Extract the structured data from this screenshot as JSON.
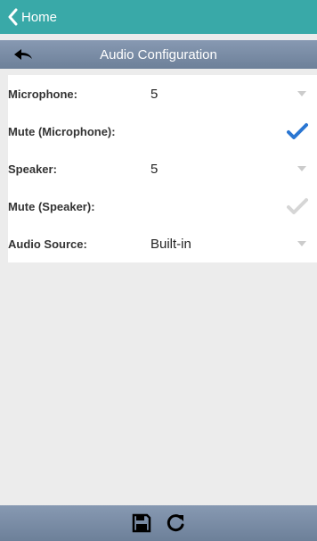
{
  "header": {
    "back_label": "Home",
    "back_icon": "chevron-left-icon"
  },
  "subheader": {
    "title": "Audio Configuration",
    "back_icon": "reply-arrow-icon"
  },
  "form": {
    "rows": [
      {
        "label": "Microphone:",
        "value": "5",
        "control": "select"
      },
      {
        "label": "Mute (Microphone):",
        "checked": true,
        "control": "checkbox"
      },
      {
        "label": "Speaker:",
        "value": "5",
        "control": "select"
      },
      {
        "label": "Mute (Speaker):",
        "checked": false,
        "control": "checkbox"
      },
      {
        "label": "Audio Source:",
        "value": "Built-in",
        "control": "select"
      }
    ]
  },
  "toolbar": {
    "save_icon": "floppy-disk-icon",
    "refresh_icon": "refresh-icon"
  },
  "colors": {
    "topbar": "#39a9a8",
    "subbar": "#7a8ca6",
    "check_active": "#2a76d2",
    "check_inactive": "#d6d6d6",
    "background": "#ececec"
  }
}
